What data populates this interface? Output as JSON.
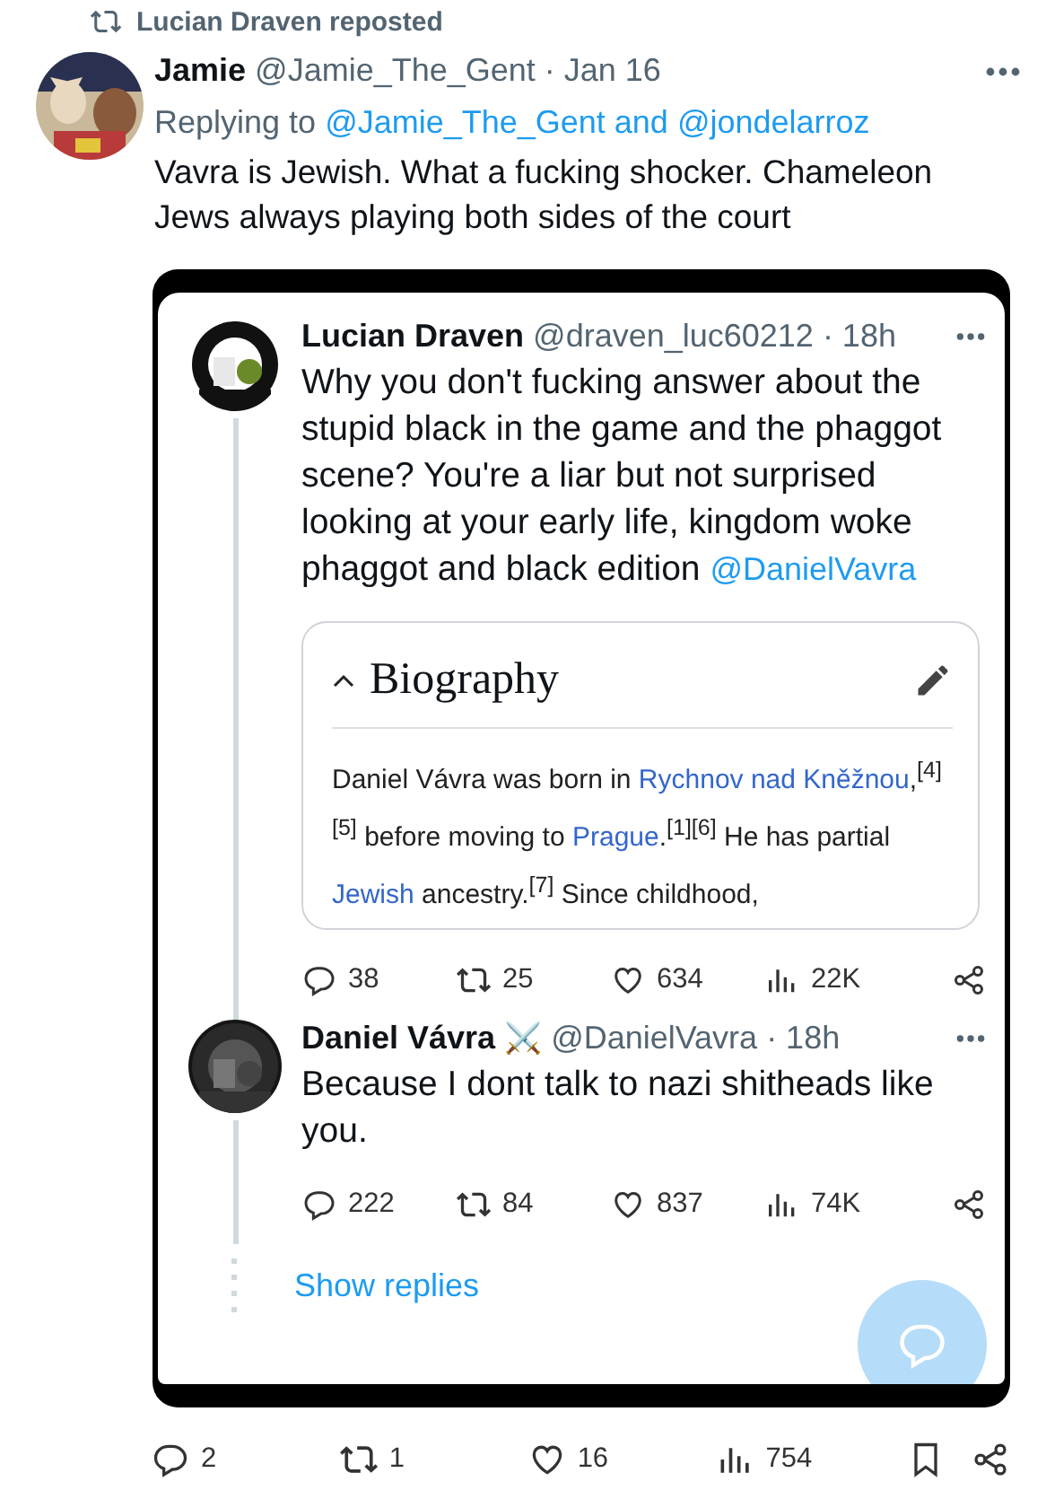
{
  "repost": {
    "label": "Lucian Draven reposted"
  },
  "tweet": {
    "name": "Jamie",
    "handle": "@Jamie_The_Gent",
    "time": "· Jan 16",
    "replying_prefix": "Replying to",
    "replying_to": "@Jamie_The_Gent and @jondelarroz",
    "text": "Vavra is Jewish. What a fucking shocker. Chameleon Jews always playing both sides of the court",
    "embedded_screenshot": {
      "posts": [
        {
          "name": "Lucian Draven",
          "handle": "@draven_luc60212",
          "time": "· 18h",
          "text": "Why you don't fucking answer about the stupid black in the game and the phaggot scene? You're a liar but not surprised looking at your early life, kingdom woke phaggot and black edition",
          "mention": "@DanielVavra",
          "card": {
            "title": "Biography",
            "expanded": true,
            "paragraph": [
              {
                "text": "Daniel Vávra was born in ",
                "link": false
              },
              {
                "text": "Rychnov nad Kněžnou",
                "link": true
              },
              {
                "text": ",$^{[4][5]}$ before moving to ",
                "link": false
              },
              {
                "text": "Prague",
                "link": true
              },
              {
                "text": ".$^{[1][6]}$ He has partial ",
                "link": false
              },
              {
                "text": "Jewish",
                "link": true
              },
              {
                "text": " ancestry.$^{[7]}$ Since childhood,",
                "link": false
              }
            ]
          },
          "actions": [
            {
              "kind": "reply",
              "count": "38"
            },
            {
              "kind": "repost",
              "count": "25"
            },
            {
              "kind": "like",
              "count": "634"
            },
            {
              "kind": "views",
              "count": "22K"
            },
            {
              "kind": "share"
            }
          ]
        },
        {
          "name": "Daniel Vávra",
          "badge": "⚔️",
          "handle": "@DanielVavra",
          "time": "· 18h",
          "text": "Because I dont talk to nazi shitheads like you.",
          "actions": [
            {
              "kind": "reply",
              "count": "222"
            },
            {
              "kind": "repost",
              "count": "84"
            },
            {
              "kind": "like",
              "count": "837"
            },
            {
              "kind": "views",
              "count": "74K"
            },
            {
              "kind": "share"
            }
          ]
        }
      ],
      "show_replies": "Show replies"
    },
    "actions": [
      {
        "kind": "reply",
        "count": "2"
      },
      {
        "kind": "repost",
        "count": "1"
      },
      {
        "kind": "like",
        "count": "16"
      },
      {
        "kind": "views",
        "count": "754"
      },
      {
        "kind": "bookmark"
      },
      {
        "kind": "share"
      }
    ]
  }
}
